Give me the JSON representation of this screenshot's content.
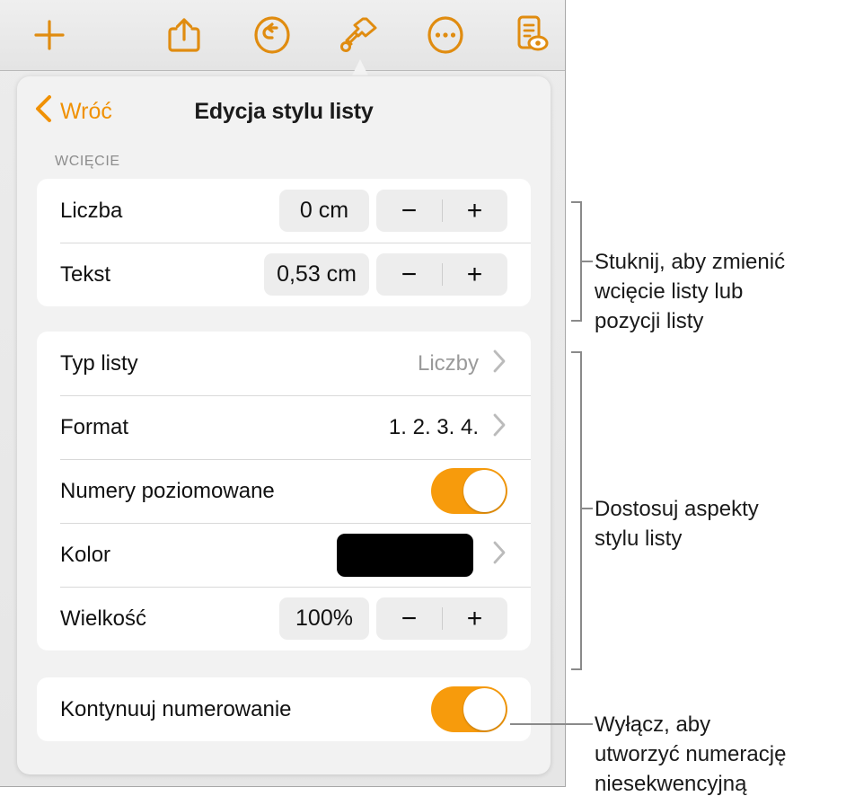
{
  "toolbar": {
    "buttons": [
      {
        "name": "add-button",
        "icon": "plus-icon",
        "label": ""
      },
      {
        "name": "share-button",
        "icon": "share-icon",
        "label": ""
      },
      {
        "name": "undo-button",
        "icon": "undo-icon",
        "label": ""
      },
      {
        "name": "format-button",
        "icon": "paintbrush-icon",
        "label": ""
      },
      {
        "name": "more-button",
        "icon": "ellipsis-circle-icon",
        "label": ""
      },
      {
        "name": "view-button",
        "icon": "document-eye-icon",
        "label": ""
      }
    ]
  },
  "popover": {
    "back_label": "Wróć",
    "title": "Edycja stylu listy",
    "indent_section": {
      "header": "WCIĘCIE",
      "rows": [
        {
          "label": "Liczba",
          "value": "0 cm",
          "minus": "−",
          "plus": "+"
        },
        {
          "label": "Tekst",
          "value": "0,53 cm",
          "minus": "−",
          "plus": "+"
        }
      ]
    },
    "style_section": {
      "list_type": {
        "label": "Typ listy",
        "value": "Liczby"
      },
      "format": {
        "label": "Format",
        "value": "1. 2. 3. 4."
      },
      "tiered_numbers": {
        "label": "Numery poziomowane",
        "state": "on"
      },
      "color": {
        "label": "Kolor",
        "swatch": "#000000"
      },
      "size": {
        "label": "Wielkość",
        "value": "100%",
        "minus": "−",
        "plus": "+"
      }
    },
    "continue_section": {
      "continue_numbering": {
        "label": "Kontynuuj numerowanie",
        "state": "on"
      }
    }
  },
  "callouts": [
    {
      "text": "Stuknij, aby zmienić\nwcięcie listy lub\npozycji listy"
    },
    {
      "text": "Dostosuj aspekty\nstylu listy"
    },
    {
      "text": "Wyłącz, aby\nutworzyć numerację\nniesekwencyjną"
    }
  ],
  "colors": {
    "accent": "#e08c10",
    "toggle_on": "#f79b0c",
    "back_link": "#f09104"
  }
}
